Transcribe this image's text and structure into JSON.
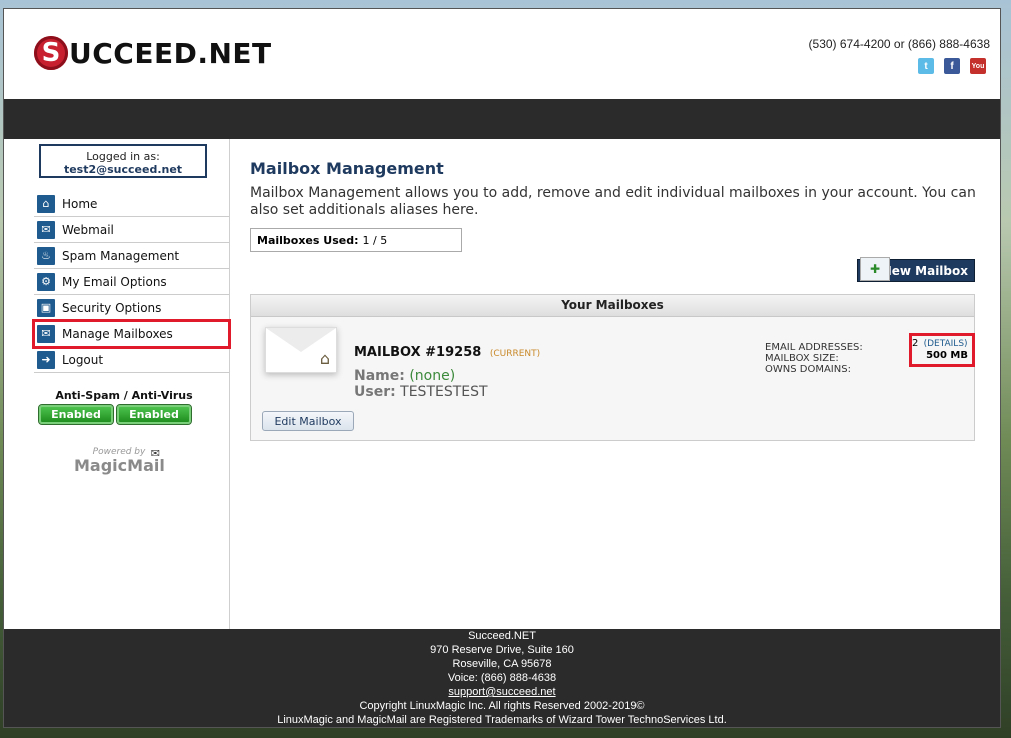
{
  "header": {
    "logo_letter": "S",
    "logo_text": "UCCEED.NET",
    "phone": "(530) 674-4200 or (866) 888-4638",
    "social": [
      "twitter-icon",
      "facebook-icon",
      "youtube-icon"
    ]
  },
  "sidebar": {
    "logged_in_label": "Logged in as:",
    "logged_in_user": "test2@succeed.net",
    "items": [
      {
        "label": "Home",
        "icon": "home-icon"
      },
      {
        "label": "Webmail",
        "icon": "envelope-icon"
      },
      {
        "label": "Spam Management",
        "icon": "flame-icon"
      },
      {
        "label": "My Email Options",
        "icon": "gear-icon"
      },
      {
        "label": "Security Options",
        "icon": "lock-icon"
      },
      {
        "label": "Manage Mailboxes",
        "icon": "envelope-icon"
      },
      {
        "label": "Logout",
        "icon": "logout-icon"
      }
    ],
    "antispam_title": "Anti-Spam / Anti-Virus",
    "antispam_status": "Enabled",
    "antivirus_status": "Enabled",
    "powered_by": "Powered by",
    "powered_brand": "MagicMail"
  },
  "main": {
    "title": "Mailbox Management",
    "description": "Mailbox Management allows you to add, remove and edit individual mailboxes in your account. You can also set additionals aliases here.",
    "used_label": "Mailboxes Used:",
    "used_value": "1 / 5",
    "new_mailbox_label": "New Mailbox",
    "panel_title": "Your Mailboxes",
    "mailbox": {
      "title": "MAILBOX #19258",
      "current": "(CURRENT)",
      "name_label": "Name:",
      "name_value": "(none)",
      "user_label": "User:",
      "user_value": "TESTESTEST",
      "edit_label": "Edit Mailbox",
      "email_addresses_label": "EMAIL ADDRESSES:",
      "mailbox_size_label": "MAILBOX SIZE:",
      "owns_domains_label": "OWNS DOMAINS:",
      "email_count": "2",
      "details_label": "(DETAILS)",
      "mailbox_size": "500 MB"
    }
  },
  "footer": {
    "company": "Succeed.NET",
    "address1": "970 Reserve Drive, Suite 160",
    "address2": "Roseville, CA 95678",
    "voice": "Voice: (866) 888-4638",
    "email": "support@succeed.net",
    "copyright": "Copyright LinuxMagic Inc. All rights Reserved 2002-2019©",
    "trademark": "LinuxMagic and MagicMail are Registered Trademarks of Wizard Tower TechnoServices Ltd."
  }
}
